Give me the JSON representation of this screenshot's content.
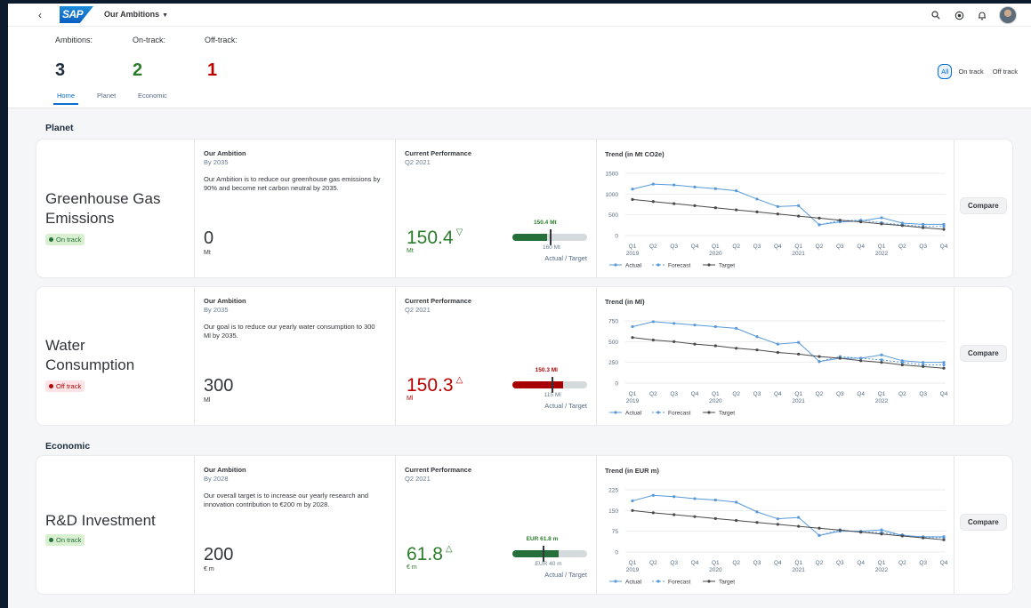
{
  "shell": {
    "back_glyph": "‹",
    "logo_text": "SAP",
    "app_title": "Our Ambitions",
    "icons": [
      "search-icon",
      "co2-icon",
      "bell-icon",
      "avatar"
    ]
  },
  "header": {
    "kpis": [
      {
        "label": "Ambitions:",
        "value": "3"
      },
      {
        "label": "On-track:",
        "value": "2"
      },
      {
        "label": "Off-track:",
        "value": "1"
      }
    ],
    "tabs": [
      "Home",
      "Planet",
      "Economic"
    ],
    "active_tab": "Home",
    "filters": [
      "All",
      "On track",
      "Off track"
    ],
    "selected_filter": "All"
  },
  "sections": {
    "planet": "Planet",
    "economic": "Economic"
  },
  "common": {
    "ambition_label": "Our Ambition",
    "perf_label": "Current Performance",
    "perf_period": "Q2 2021",
    "actual_target": "Actual / Target",
    "compare": "Compare",
    "legend": [
      "Actual",
      "Forecast",
      "Target"
    ],
    "quarters": [
      "Q1",
      "Q2",
      "Q3",
      "Q4",
      "Q1",
      "Q2",
      "Q3",
      "Q4",
      "Q1",
      "Q2",
      "Q3",
      "Q4",
      "Q1",
      "Q2",
      "Q3",
      "Q4"
    ],
    "years": [
      "2019",
      "2020",
      "2021",
      "2022"
    ]
  },
  "goals": [
    {
      "name_line1": "Greenhouse Gas",
      "name_line2": "Emissions",
      "status": "On track",
      "by": "By 2035",
      "description": "Our Ambition is to reduce our greenhouse gas emissions by 90% and become net carbon neutral by 2035.",
      "target_value": "0",
      "target_unit": "Mt",
      "current_value": "150.4",
      "current_unit": "Mt",
      "direction": "down",
      "bullet_actual_label": "150.4 Mt",
      "bullet_target_label": "160 Mt",
      "bullet_fill_fraction": 0.47,
      "bullet_tick_fraction": 0.5,
      "color": "#2b7d2b",
      "trend_title": "Trend (in Mt CO2e)",
      "y_ticks": [
        "1500",
        "1000",
        "500",
        "0"
      ],
      "chart_data": {
        "type": "line",
        "ylim": [
          0,
          1500
        ],
        "series": [
          {
            "name": "Actual",
            "values": [
              1120,
              1240,
              1220,
              1170,
              1130,
              1080,
              880,
              700,
              720,
              260,
              330,
              350,
              430,
              300,
              270,
              270
            ]
          },
          {
            "name": "Forecast",
            "values": [
              null,
              null,
              null,
              null,
              null,
              null,
              null,
              null,
              null,
              260,
              360,
              370,
              310,
              260,
              220,
              220
            ]
          },
          {
            "name": "Target",
            "values": [
              870,
              820,
              770,
              720,
              670,
              620,
              570,
              520,
              470,
              420,
              370,
              330,
              280,
              240,
              190,
              150
            ]
          }
        ]
      }
    },
    {
      "name_line1": "Water",
      "name_line2": "Consumption",
      "status": "Off track",
      "by": "By 2035",
      "description": "Our goal is to reduce our yearly water consumption to 300 Ml by 2035.",
      "target_value": "300",
      "target_unit": "Ml",
      "current_value": "150.3",
      "current_unit": "Ml",
      "direction": "up",
      "bullet_actual_label": "150.3 Ml",
      "bullet_target_label": "115 Ml",
      "bullet_fill_fraction": 0.68,
      "bullet_tick_fraction": 0.52,
      "color": "#aa0808",
      "trend_title": "Trend (in Ml)",
      "y_ticks": [
        "750",
        "500",
        "250",
        "0"
      ],
      "chart_data": {
        "type": "line",
        "ylim": [
          0,
          750
        ],
        "series": [
          {
            "name": "Actual",
            "values": [
              680,
              740,
              720,
              700,
              680,
              660,
              560,
              470,
              490,
              260,
              300,
              300,
              340,
              270,
              250,
              250
            ]
          },
          {
            "name": "Forecast",
            "values": [
              null,
              null,
              null,
              null,
              null,
              null,
              null,
              null,
              null,
              260,
              320,
              300,
              280,
              250,
              220,
              220
            ]
          },
          {
            "name": "Target",
            "values": [
              550,
              520,
              500,
              470,
              450,
              420,
              400,
              370,
              350,
              320,
              300,
              270,
              250,
              220,
              200,
              180
            ]
          }
        ]
      }
    },
    {
      "name_line1": "R&D Investment",
      "name_line2": "",
      "status": "On track",
      "by": "By 2028",
      "description": "Our overall target is to increase our yearly research and innovation contribution to €200 m by 2028.",
      "target_value": "200",
      "target_unit": "€ m",
      "current_value": "61.8",
      "current_unit": "€ m",
      "direction": "up",
      "bullet_actual_label": "EUR 61.8 m",
      "bullet_target_label": "EUR 40 m",
      "bullet_fill_fraction": 0.62,
      "bullet_tick_fraction": 0.4,
      "color": "#2b7d2b",
      "trend_title": "Trend (in EUR m)",
      "y_ticks": [
        "225",
        "150",
        "75",
        "0"
      ],
      "chart_data": {
        "type": "line",
        "ylim": [
          0,
          225
        ],
        "series": [
          {
            "name": "Actual",
            "values": [
              185,
              205,
              200,
              193,
              188,
              180,
              145,
              120,
              125,
              60,
              75,
              75,
              80,
              60,
              55,
              55
            ]
          },
          {
            "name": "Forecast",
            "values": [
              null,
              null,
              null,
              null,
              null,
              null,
              null,
              null,
              null,
              60,
              80,
              72,
              70,
              62,
              52,
              52
            ]
          },
          {
            "name": "Target",
            "values": [
              150,
              142,
              135,
              128,
              121,
              114,
              107,
              100,
              93,
              86,
              79,
              72,
              65,
              58,
              51,
              44
            ]
          }
        ]
      }
    }
  ]
}
